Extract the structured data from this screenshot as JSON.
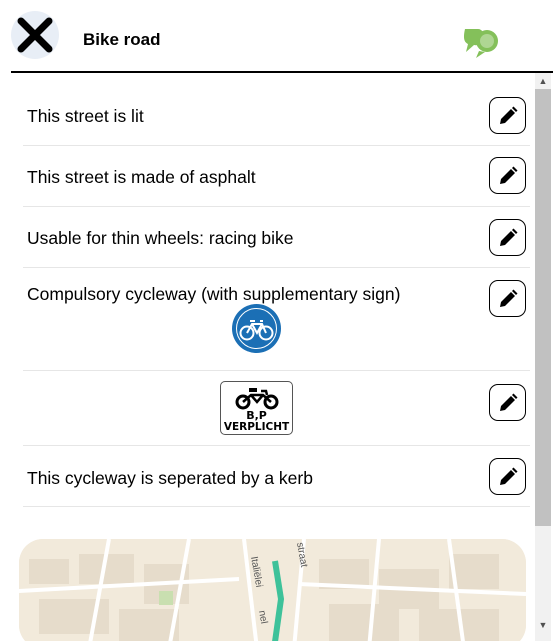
{
  "header": {
    "title": "Bike road",
    "close_icon": "close-icon",
    "chat_icon": "speech-bubbles-icon",
    "chat_icon_color": "#84c05a"
  },
  "rows": [
    {
      "label": "This street is lit",
      "edit_icon": "pencil-icon"
    },
    {
      "label": "This street is made of asphalt",
      "edit_icon": "pencil-icon"
    },
    {
      "label": "Usable for thin wheels: racing bike",
      "edit_icon": "pencil-icon"
    },
    {
      "label": "Compulsory cycleway (with supplementary sign)",
      "edit_icon": "pencil-icon",
      "sign_icon": "bicycle-sign-icon",
      "sign_color": "#1b6fb5"
    },
    {
      "label": "",
      "edit_icon": "pencil-icon",
      "sign_icon": "moped-sign-icon",
      "sign_text_line1": "B,P",
      "sign_text_line2": "VERPLICHT"
    },
    {
      "label": "This cycleway is seperated by a kerb",
      "edit_icon": "pencil-icon"
    }
  ],
  "map": {
    "street_labels": [
      "Italiëlei",
      "straat",
      "nel"
    ],
    "route_color": "#3ec29a"
  }
}
